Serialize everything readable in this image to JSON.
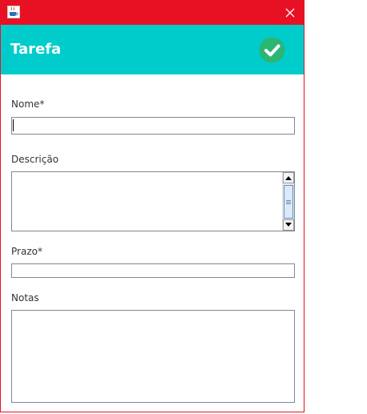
{
  "window": {
    "title_bar_color": "#e81123",
    "app_icon": "java-coffee-icon",
    "close_icon": "close-icon"
  },
  "header": {
    "title": "Tarefa",
    "background": "#00cccc",
    "confirm_icon": "check-circle-icon",
    "confirm_color": "#2bb673"
  },
  "form": {
    "nome_label": "Nome*",
    "nome_value": "",
    "descricao_label": "Descrição",
    "descricao_value": "",
    "prazo_label": "Prazo*",
    "prazo_value": "",
    "notas_label": "Notas",
    "notas_value": ""
  }
}
